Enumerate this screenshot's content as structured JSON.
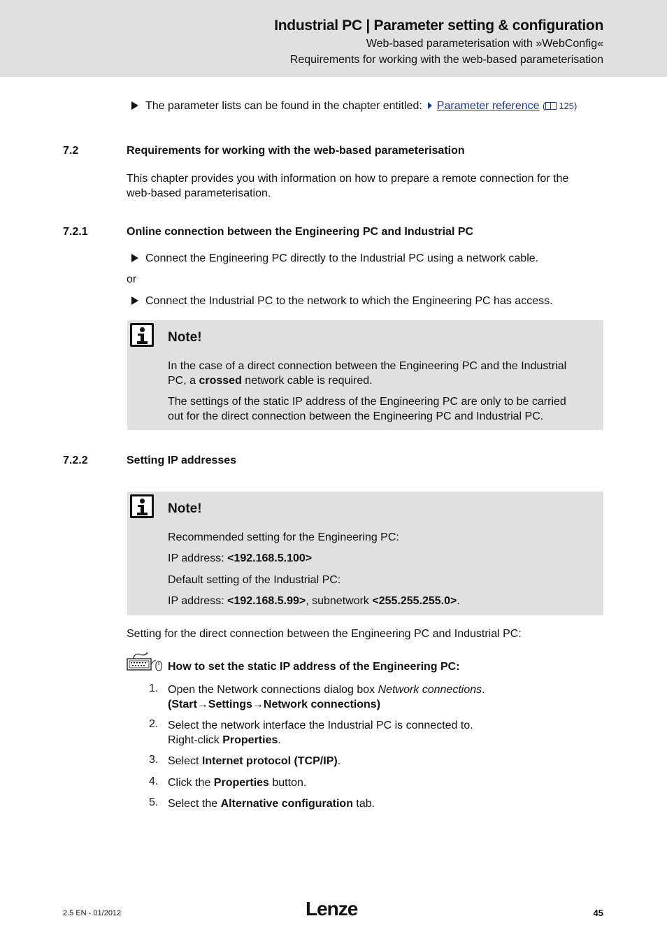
{
  "header": {
    "title": "Industrial PC | Parameter setting & configuration",
    "subtitle_1": "Web-based parameterisation with »WebConfig«",
    "subtitle_2": "Requirements for working with the web-based parameterisation"
  },
  "intro_bullet": {
    "text": "The parameter lists can be found in the chapter entitled:",
    "link_label": "Parameter reference",
    "page_ref": "125",
    "icons": {
      "bullet": "triangle-right-icon",
      "link_arrow": "small-triangle-right-icon",
      "book": "book-icon"
    }
  },
  "section_7_2": {
    "number": "7.2",
    "title": "Requirements for working with the web-based parameterisation",
    "paragraph_line_1": "This chapter provides you with information on how to prepare a remote connection for the",
    "paragraph_line_2": "web-based parameterisation."
  },
  "section_7_2_1": {
    "number": "7.2.1",
    "title": "Online connection between the Engineering PC and Industrial PC",
    "bullet_1": "Connect the Engineering PC directly to the Industrial PC using a network cable.",
    "or_label": "or",
    "bullet_2": "Connect the Industrial PC to the network to which the Engineering PC has access.",
    "note": {
      "icon": "info-icon",
      "title": "Note!",
      "p1_line1": "In the case of a direct connection between the Engineering PC and the Industrial",
      "p1_line2_pre": "PC, a ",
      "p1_line2_bold": "crossed",
      "p1_line2_post": " network cable is required.",
      "p2_line1": "The settings of the static IP address of the Engineering PC are only to be carried",
      "p2_line2": "out for the direct connection between the Engineering PC and Industrial PC."
    }
  },
  "section_7_2_2": {
    "number": "7.2.2",
    "title": "Setting IP addresses",
    "note": {
      "icon": "info-icon",
      "title": "Note!",
      "line1": "Recommended setting for the Engineering PC:",
      "line2_pre": "IP address: ",
      "line2_bold": "<192.168.5.100>",
      "line3": "Default setting of the Industrial PC:",
      "line4_pre": "IP address: ",
      "line4_bold1": "<192.168.5.99>",
      "line4_mid": ", subnetwork ",
      "line4_bold2": "<255.255.255.0>",
      "line4_post": "."
    },
    "setting_intro": "Setting for the direct connection between the Engineering PC and Industrial PC:",
    "howto": {
      "icon": "keyboard-mouse-icon",
      "title": "How to set the static IP address of the Engineering PC:",
      "steps": [
        {
          "num": "1.",
          "pre": "Open the Network connections dialog box ",
          "italic": "Network connections",
          "post": ".",
          "line2": "(Start→Settings→Network connections)"
        },
        {
          "num": "2.",
          "line1": "Select the network interface the Industrial PC is connected to.",
          "line2_pre": "Right-click ",
          "line2_bold": "Properties",
          "line2_post": "."
        },
        {
          "num": "3.",
          "pre": "Select ",
          "bold": "Internet protocol (TCP/IP)",
          "post": "."
        },
        {
          "num": "4.",
          "pre": "Click the ",
          "bold": "Properties",
          "post": " button."
        },
        {
          "num": "5.",
          "pre": "Select the ",
          "bold": "Alternative configuration",
          "post": " tab."
        }
      ]
    }
  },
  "footer": {
    "version": "2.5 EN - 01/2012",
    "logo": "Lenze",
    "page_number": "45"
  }
}
